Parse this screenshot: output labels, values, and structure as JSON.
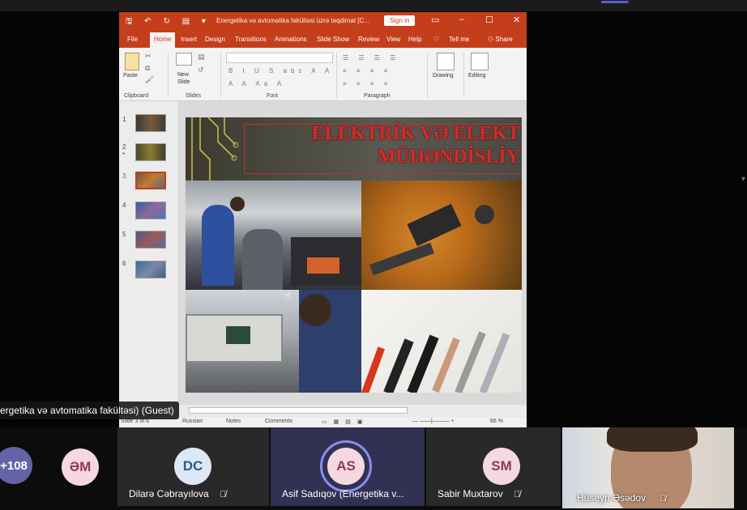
{
  "ppt": {
    "doc_title": "Energetika və avtomatika fakültəsi üzrə təqdimat [C...",
    "signin_label": "Sign in",
    "menu": [
      "File",
      "Home",
      "Insert",
      "Design",
      "Transitions",
      "Animations",
      "Slide Show",
      "Review",
      "View",
      "Help"
    ],
    "tell_me": "Tell me",
    "share": "Share",
    "ribbon": {
      "paste": "Paste",
      "new_slide": "New Slide",
      "drawing": "Drawing",
      "editing": "Editing",
      "groups": [
        "Clipboard",
        "Slides",
        "Font",
        "Paragraph"
      ]
    },
    "slide_numbers": [
      "1",
      "2",
      "3",
      "4",
      "5",
      "6"
    ],
    "selected_slide": 3,
    "slide_title_line1": "ELEKTRİK VƏ ELEKT",
    "slide_title_line2": "MÜHƏNDİSLİY",
    "status": {
      "slide_of": "Slide 3 of 6",
      "language": "Russian",
      "notes": "Notes",
      "comments": "Comments",
      "zoom": "66 %"
    }
  },
  "presenter_label": "ergetika və avtomatika fakültəsi) (Guest)",
  "participants": {
    "overflow": "+108",
    "tiles": [
      {
        "initials": "ƏM",
        "name": ""
      },
      {
        "initials": "DC",
        "name": "Dilarə Cəbrayılova"
      },
      {
        "initials": "AS",
        "name": "Asif Sadıqov (Energetika v..."
      },
      {
        "initials": "SM",
        "name": "Sabir Muxtarov"
      }
    ],
    "video_name": "Hüseyn Əsədov"
  },
  "colors": {
    "ppt_accent": "#c43e1c",
    "teams_purple": "#5b5fc7",
    "avatar_bg": "#f6d9e0",
    "avatar_dc_bg": "#dce8f5",
    "overflow_bg": "#6264a7"
  }
}
